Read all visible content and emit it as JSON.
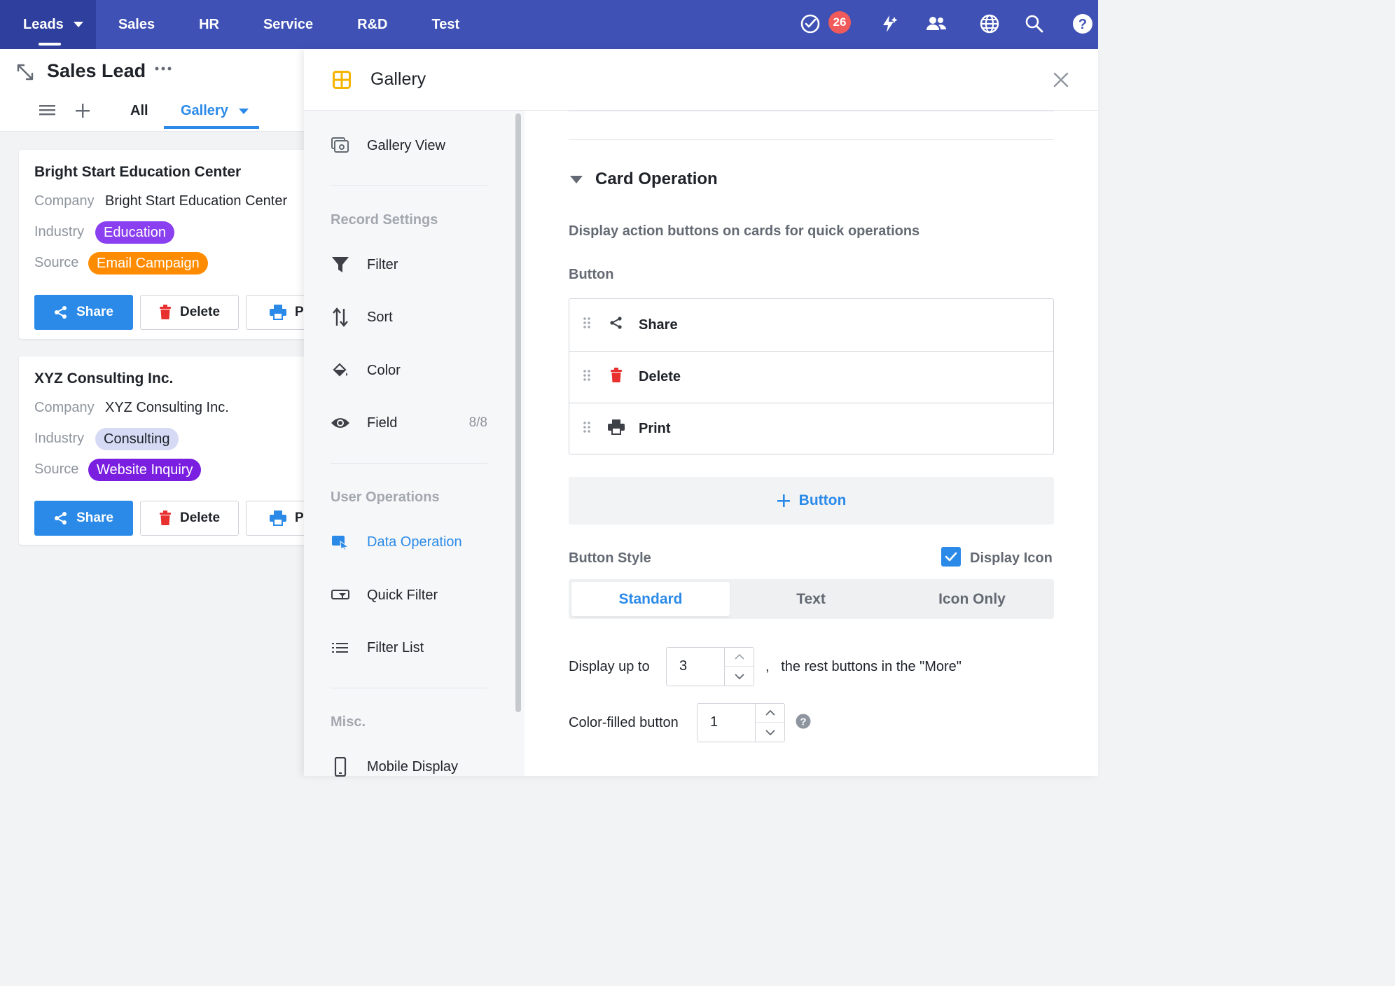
{
  "nav": {
    "tabs": [
      "Leads",
      "Sales",
      "HR",
      "Service",
      "R&D",
      "Test"
    ],
    "badge_count": "26",
    "icons": [
      "tasks-check-icon",
      "lightning-icon",
      "users-icon",
      "globe-icon",
      "search-icon",
      "help-icon"
    ]
  },
  "list": {
    "title": "Sales Lead",
    "tab_all": "All",
    "tab_gallery": "Gallery",
    "cards": [
      {
        "title": "Bright Start Education Center",
        "company_label": "Company",
        "company": "Bright Start Education Center",
        "industry_label": "Industry",
        "industry": "Education",
        "source_label": "Source",
        "source": "Email Campaign",
        "btn_share": "Share",
        "btn_delete": "Delete",
        "btn_print": "Pr"
      },
      {
        "title": "XYZ Consulting Inc.",
        "company_label": "Company",
        "company": "XYZ Consulting Inc.",
        "industry_label": "Industry",
        "industry": "Consulting",
        "source_label": "Source",
        "source": "Website Inquiry",
        "btn_share": "Share",
        "btn_delete": "Delete",
        "btn_print": "Pr"
      }
    ]
  },
  "panel": {
    "title": "Gallery",
    "side": {
      "gallery_view": "Gallery View",
      "record_settings": "Record Settings",
      "filter": "Filter",
      "sort": "Sort",
      "color": "Color",
      "field": "Field",
      "field_count": "8/8",
      "user_operations": "User Operations",
      "data_operation": "Data Operation",
      "quick_filter": "Quick Filter",
      "filter_list": "Filter List",
      "misc": "Misc.",
      "mobile_display": "Mobile Display"
    },
    "card_operation": {
      "title": "Card Operation",
      "description": "Display action buttons on cards for quick operations",
      "button_label": "Button",
      "buttons": [
        "Share",
        "Delete",
        "Print"
      ],
      "add_button": "Button",
      "button_style_label": "Button Style",
      "display_icon": "Display Icon",
      "styles": [
        "Standard",
        "Text",
        "Icon Only"
      ],
      "selected_style": "Standard",
      "display_up_to": "Display up to",
      "display_up_to_value": "3",
      "rest_text": ",   the rest buttons in the \"More\"",
      "color_filled": "Color-filled button",
      "color_filled_value": "1"
    }
  },
  "colors": {
    "nav_bg": "#3f51b5",
    "accent": "#2b8ae8",
    "tag_education": "#8a3ff0",
    "tag_email": "#ff8c00",
    "tag_consulting": "#d6daf5",
    "tag_website": "#7a1ee0",
    "delete_red": "#e8302f"
  }
}
